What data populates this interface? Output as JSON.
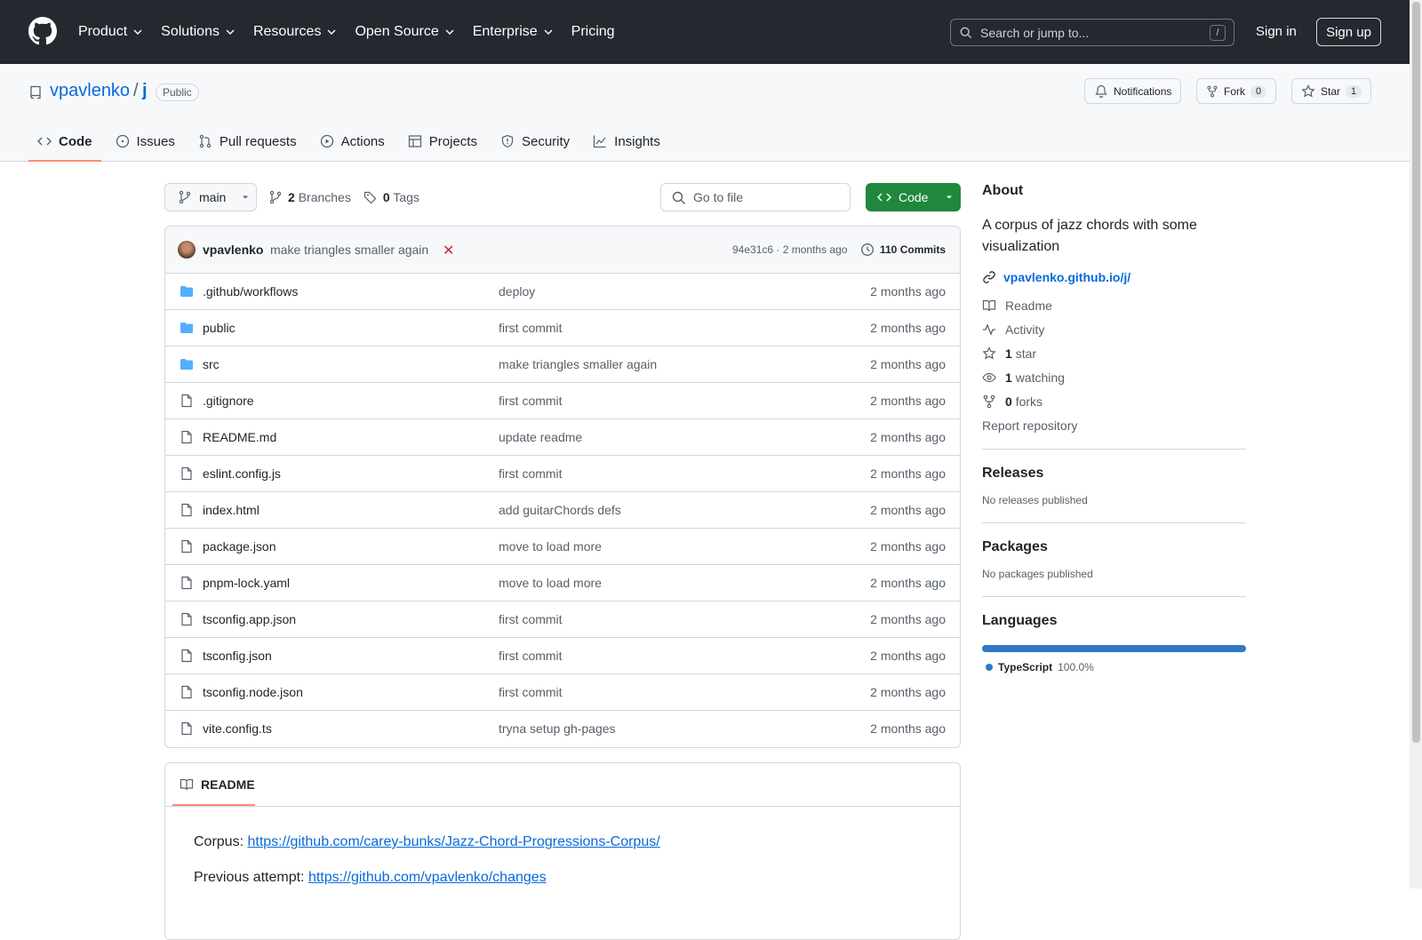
{
  "header": {
    "nav": [
      "Product",
      "Solutions",
      "Resources",
      "Open Source",
      "Enterprise",
      "Pricing"
    ],
    "search_placeholder": "Search or jump to...",
    "search_shortcut": "/",
    "sign_in": "Sign in",
    "sign_up": "Sign up"
  },
  "repo": {
    "owner": "vpavlenko",
    "separator": "/",
    "name": "j",
    "visibility": "Public",
    "notifications_label": "Notifications",
    "fork_label": "Fork",
    "fork_count": "0",
    "star_label": "Star",
    "star_count": "1",
    "tabs": [
      "Code",
      "Issues",
      "Pull requests",
      "Actions",
      "Projects",
      "Security",
      "Insights"
    ]
  },
  "toolbar": {
    "branch": "main",
    "branches_count": "2",
    "branches_label": "Branches",
    "tags_count": "0",
    "tags_label": "Tags",
    "goto_placeholder": "Go to file",
    "code_label": "Code"
  },
  "commit": {
    "author": "vpavlenko",
    "message": "make triangles smaller again",
    "status_icon": "✕",
    "hash_time": "94e31c6 · 2 months ago",
    "commits_label": "110 Commits"
  },
  "files": [
    {
      "name": ".github/workflows",
      "type": "folder",
      "msg": "deploy",
      "date": "2 months ago"
    },
    {
      "name": "public",
      "type": "folder",
      "msg": "first commit",
      "date": "2 months ago"
    },
    {
      "name": "src",
      "type": "folder",
      "msg": "make triangles smaller again",
      "date": "2 months ago"
    },
    {
      "name": ".gitignore",
      "type": "file",
      "msg": "first commit",
      "date": "2 months ago"
    },
    {
      "name": "README.md",
      "type": "file",
      "msg": "update readme",
      "date": "2 months ago"
    },
    {
      "name": "eslint.config.js",
      "type": "file",
      "msg": "first commit",
      "date": "2 months ago"
    },
    {
      "name": "index.html",
      "type": "file",
      "msg": "add guitarChords defs",
      "date": "2 months ago"
    },
    {
      "name": "package.json",
      "type": "file",
      "msg": "move to load more",
      "date": "2 months ago"
    },
    {
      "name": "pnpm-lock.yaml",
      "type": "file",
      "msg": "move to load more",
      "date": "2 months ago"
    },
    {
      "name": "tsconfig.app.json",
      "type": "file",
      "msg": "first commit",
      "date": "2 months ago"
    },
    {
      "name": "tsconfig.json",
      "type": "file",
      "msg": "first commit",
      "date": "2 months ago"
    },
    {
      "name": "tsconfig.node.json",
      "type": "file",
      "msg": "first commit",
      "date": "2 months ago"
    },
    {
      "name": "vite.config.ts",
      "type": "file",
      "msg": "tryna setup gh-pages",
      "date": "2 months ago"
    }
  ],
  "readme": {
    "tab": "README",
    "line1_label": "Corpus:",
    "line1_link": "https://github.com/carey-bunks/Jazz-Chord-Progressions-Corpus/",
    "line2_label": "Previous attempt:",
    "line2_link": "https://github.com/vpavlenko/changes"
  },
  "about": {
    "title": "About",
    "description": "A corpus of jazz chords with some visualization",
    "link": "vpavlenko.github.io/j/",
    "readme": "Readme",
    "activity": "Activity",
    "stars_count": "1",
    "stars_label": "star",
    "watching_count": "1",
    "watching_label": "watching",
    "forks_count": "0",
    "forks_label": "forks",
    "report": "Report repository"
  },
  "releases": {
    "title": "Releases",
    "text": "No releases published"
  },
  "packages": {
    "title": "Packages",
    "text": "No packages published"
  },
  "languages": {
    "title": "Languages",
    "name": "TypeScript",
    "percent": "100.0%",
    "fraction": 1.0,
    "color": "#3178c6"
  }
}
